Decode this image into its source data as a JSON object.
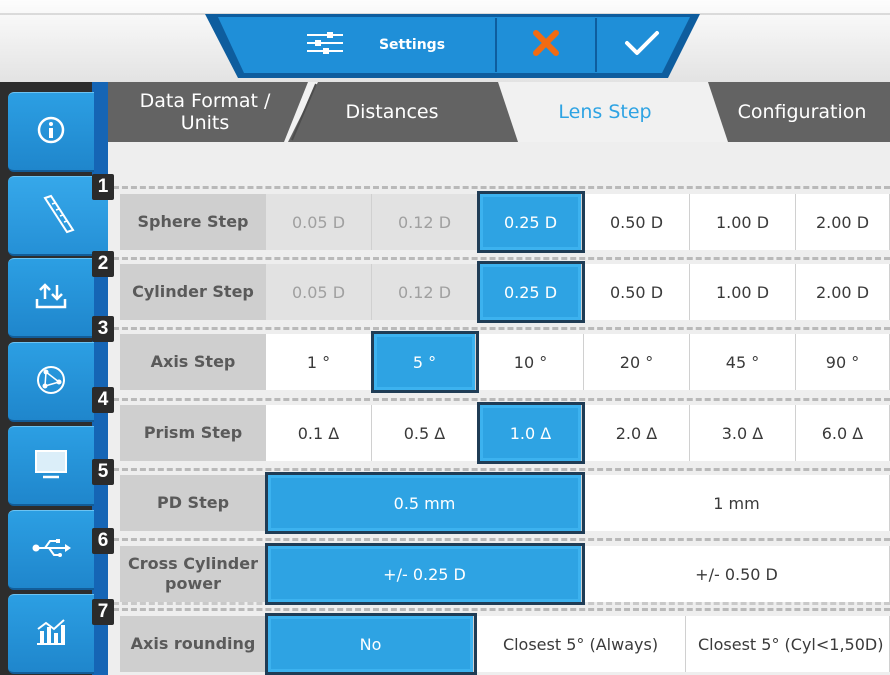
{
  "toolbar": {
    "settings_label": "Settings",
    "settings_icon": "sliders-icon",
    "cancel_icon": "close-x-icon",
    "confirm_icon": "checkmark-icon",
    "cancel_color": "#f26b12"
  },
  "sidebar": {
    "items": [
      {
        "icon": "info-icon"
      },
      {
        "icon": "ruler-icon"
      },
      {
        "icon": "upload-download-icon"
      },
      {
        "icon": "network-globe-icon"
      },
      {
        "icon": "monitor-icon"
      },
      {
        "icon": "usb-icon"
      },
      {
        "icon": "chart-icon"
      }
    ]
  },
  "tabs": {
    "data_format": "Data Format / Units",
    "data_format_line1": "Data Format /",
    "data_format_line2": "Units",
    "distances": "Distances",
    "lens_step": "Lens Step",
    "configuration": "Configuration",
    "active": "Lens Step"
  },
  "rows": [
    {
      "number": "1",
      "label": "Sphere Step",
      "options": [
        "0.05 D",
        "0.12 D",
        "0.25 D",
        "0.50 D",
        "1.00 D",
        "2.00 D"
      ],
      "selected": "0.25 D",
      "disabled": [
        "0.05 D",
        "0.12 D"
      ]
    },
    {
      "number": "2",
      "label": "Cylinder Step",
      "options": [
        "0.05 D",
        "0.12 D",
        "0.25 D",
        "0.50 D",
        "1.00 D",
        "2.00 D"
      ],
      "selected": "0.25 D",
      "disabled": [
        "0.05 D",
        "0.12 D"
      ]
    },
    {
      "number": "3",
      "label": "Axis Step",
      "options": [
        "1 °",
        "5 °",
        "10 °",
        "20 °",
        "45 °",
        "90 °"
      ],
      "selected": "5 °"
    },
    {
      "number": "4",
      "label": "Prism Step",
      "options": [
        "0.1 Δ",
        "0.5 Δ",
        "1.0 Δ",
        "2.0 Δ",
        "3.0 Δ",
        "6.0 Δ"
      ],
      "selected": "1.0 Δ"
    },
    {
      "number": "5",
      "label": "PD Step",
      "options": [
        "0.5 mm",
        "1 mm"
      ],
      "selected": "0.5 mm"
    },
    {
      "number": "6",
      "label": "Cross Cylinder power",
      "label_line1": "Cross Cylinder",
      "label_line2": "power",
      "options": [
        "+/- 0.25 D",
        "+/- 0.50 D"
      ],
      "selected": "+/- 0.25 D"
    },
    {
      "number": "7",
      "label": "Axis rounding",
      "options": [
        "No",
        "Closest 5° (Always)",
        "Closest 5° (Cyl<1,50D)"
      ],
      "selected": "No"
    }
  ],
  "colors": {
    "accent": "#2ea3e3",
    "sidebar": "#2c9fe3",
    "toolbar": "#1f8fd8"
  }
}
